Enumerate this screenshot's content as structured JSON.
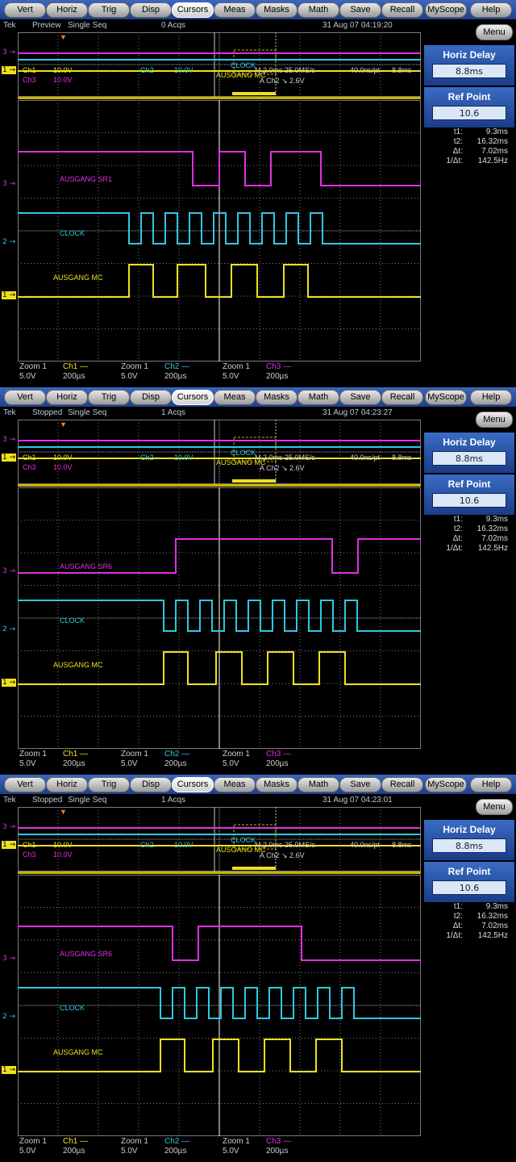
{
  "menu": [
    "Vert",
    "Horiz",
    "Trig",
    "Disp",
    "Cursors",
    "Meas",
    "Masks",
    "Math",
    "Save",
    "Recall",
    "MyScope",
    "Help"
  ],
  "active_menu": "Cursors",
  "colors": {
    "ch1": "#f0e020",
    "ch2": "#30c8e0",
    "ch3": "#e030e0",
    "grid": "#7a7a7a",
    "bg": "#000000"
  },
  "side": {
    "menu_label": "Menu",
    "horiz_delay_label": "Horiz Delay",
    "horiz_delay_value": "8.8ms",
    "ref_point_label": "Ref Point",
    "ref_point_value": "10.6",
    "cursors": [
      {
        "k": "t1:",
        "v": "9.3ms"
      },
      {
        "k": "t2:",
        "v": "16.32ms"
      },
      {
        "k": "Δt:",
        "v": "7.02ms"
      },
      {
        "k": "1/Δt:",
        "v": "142.5Hz"
      }
    ]
  },
  "overview_info": {
    "ch1": "Ch1",
    "ch1_scale": "10.0V",
    "ch2": "Ch2",
    "ch2_scale": "10.0V",
    "ch3": "Ch3",
    "ch3_scale": "10.0V",
    "timebase": "M 2.0ms 25.0MS/s",
    "resolution": "40.0ns/pt",
    "delay": "8.8ms",
    "trigger": "A  Ch2  ↘  2.6V",
    "overlay_a": "CLOCK",
    "overlay_b": "AUSGANG MC"
  },
  "bottom": [
    {
      "zoom": "Zoom 1",
      "ch": "Ch1",
      "v": "5.0V",
      "t": "200µs",
      "color": "#f0e020"
    },
    {
      "zoom": "Zoom 1",
      "ch": "Ch2",
      "v": "5.0V",
      "t": "200µs",
      "color": "#30c8e0"
    },
    {
      "zoom": "Zoom 1",
      "ch": "Ch3",
      "v": "5.0V",
      "t": "200µs",
      "color": "#e030e0"
    }
  ],
  "channel_marks": {
    "ch1": "1",
    "ch2": "2",
    "ch3": "3"
  },
  "panels": [
    {
      "brand": "Tek",
      "mode": "Preview",
      "acq_mode": "Single Seq",
      "acqs": "0 Acqs",
      "datetime": "31 Aug 07 04:19:20",
      "label_ch3": "AUSGANG SR1",
      "label_ch2": "CLOCK",
      "label_ch1": "AUSGANG MC",
      "chart_data": {
        "type": "line",
        "x_unit": "division",
        "xlim": [
          0,
          10
        ],
        "series": [
          {
            "name": "AUSGANG SR1",
            "channel": "Ch3",
            "x": [
              0,
              4.34,
              4.34,
              5.0,
              5.0,
              5.64,
              5.64,
              6.28,
              6.28,
              7.52,
              7.52,
              10
            ],
            "y": [
              1,
              1,
              0,
              0,
              1,
              1,
              0,
              0,
              1,
              1,
              0,
              0
            ]
          },
          {
            "name": "CLOCK",
            "channel": "Ch2",
            "x": [
              0,
              2.76,
              2.76,
              3.06,
              3.06,
              3.36,
              3.36,
              3.66,
              3.66,
              3.96,
              3.96,
              4.26,
              4.26,
              4.56,
              4.56,
              4.86,
              4.86,
              5.16,
              5.16,
              5.46,
              5.46,
              5.76,
              5.76,
              6.06,
              6.06,
              6.36,
              6.36,
              6.66,
              6.66,
              6.96,
              6.96,
              7.26,
              7.26,
              7.56,
              7.56,
              10
            ],
            "y": [
              1,
              1,
              0,
              0,
              1,
              1,
              0,
              0,
              1,
              1,
              0,
              0,
              1,
              1,
              0,
              0,
              1,
              1,
              0,
              0,
              1,
              1,
              0,
              0,
              1,
              1,
              0,
              0,
              1,
              1,
              0,
              0,
              1,
              1,
              0,
              0
            ]
          },
          {
            "name": "AUSGANG MC",
            "channel": "Ch1",
            "x": [
              0,
              2.76,
              2.76,
              3.36,
              3.36,
              3.96,
              3.96,
              4.66,
              4.66,
              5.3,
              5.3,
              5.94,
              5.94,
              6.6,
              6.6,
              7.2,
              7.2,
              10
            ],
            "y": [
              0,
              0,
              1,
              1,
              0,
              0,
              1,
              1,
              0,
              0,
              1,
              1,
              0,
              0,
              1,
              1,
              0,
              0
            ]
          }
        ]
      }
    },
    {
      "brand": "Tek",
      "mode": "Stopped",
      "acq_mode": "Single Seq",
      "acqs": "1 Acqs",
      "datetime": "31 Aug 07 04:23:27",
      "label_ch3": "AUSGANG SR6",
      "label_ch2": "CLOCK",
      "label_ch1": "AUSGANG MC",
      "chart_data": {
        "type": "line",
        "x_unit": "division",
        "xlim": [
          0,
          10
        ],
        "series": [
          {
            "name": "AUSGANG SR6",
            "channel": "Ch3",
            "x": [
              0,
              3.92,
              3.92,
              7.8,
              7.8,
              8.44,
              8.44,
              10
            ],
            "y": [
              0,
              0,
              1,
              1,
              0,
              0,
              1,
              1
            ]
          },
          {
            "name": "CLOCK",
            "channel": "Ch2",
            "x": [
              0,
              3.62,
              3.62,
              3.92,
              3.92,
              4.22,
              4.22,
              4.52,
              4.52,
              4.82,
              4.82,
              5.12,
              5.12,
              5.42,
              5.42,
              5.72,
              5.72,
              6.02,
              6.02,
              6.32,
              6.32,
              6.62,
              6.62,
              6.92,
              6.92,
              7.22,
              7.22,
              7.52,
              7.52,
              7.82,
              7.82,
              8.12,
              8.12,
              8.42,
              8.42,
              10
            ],
            "y": [
              1,
              1,
              0,
              0,
              1,
              1,
              0,
              0,
              1,
              1,
              0,
              0,
              1,
              1,
              0,
              0,
              1,
              1,
              0,
              0,
              1,
              1,
              0,
              0,
              1,
              1,
              0,
              0,
              1,
              1,
              0,
              0,
              1,
              1,
              0,
              0
            ]
          },
          {
            "name": "AUSGANG MC",
            "channel": "Ch1",
            "x": [
              0,
              3.62,
              3.62,
              4.22,
              4.22,
              4.92,
              4.92,
              5.56,
              5.56,
              6.2,
              6.2,
              6.84,
              6.84,
              7.48,
              7.48,
              8.12,
              8.12,
              10
            ],
            "y": [
              0,
              0,
              1,
              1,
              0,
              0,
              1,
              1,
              0,
              0,
              1,
              1,
              0,
              0,
              1,
              1,
              0,
              0
            ]
          }
        ]
      }
    },
    {
      "brand": "Tek",
      "mode": "Stopped",
      "acq_mode": "Single Seq",
      "acqs": "1 Acqs",
      "datetime": "31 Aug 07 04:23:01",
      "label_ch3": "AUSGANG SR6",
      "label_ch2": "CLOCK",
      "label_ch1": "AUSGANG MC",
      "chart_data": {
        "type": "line",
        "x_unit": "division",
        "xlim": [
          0,
          10
        ],
        "series": [
          {
            "name": "AUSGANG SR6",
            "channel": "Ch3",
            "x": [
              0,
              3.84,
              3.84,
              4.48,
              4.48,
              7.04,
              7.04,
              10
            ],
            "y": [
              1,
              1,
              0,
              0,
              1,
              1,
              0,
              0
            ]
          },
          {
            "name": "CLOCK",
            "channel": "Ch2",
            "x": [
              0,
              3.54,
              3.54,
              3.84,
              3.84,
              4.14,
              4.14,
              4.44,
              4.44,
              4.74,
              4.74,
              5.04,
              5.04,
              5.34,
              5.34,
              5.64,
              5.64,
              5.94,
              5.94,
              6.24,
              6.24,
              6.54,
              6.54,
              6.84,
              6.84,
              7.14,
              7.14,
              7.44,
              7.44,
              7.74,
              7.74,
              8.04,
              8.04,
              8.34,
              8.34,
              10
            ],
            "y": [
              1,
              1,
              0,
              0,
              1,
              1,
              0,
              0,
              1,
              1,
              0,
              0,
              1,
              1,
              0,
              0,
              1,
              1,
              0,
              0,
              1,
              1,
              0,
              0,
              1,
              1,
              0,
              0,
              1,
              1,
              0,
              0,
              1,
              1,
              0,
              0
            ]
          },
          {
            "name": "AUSGANG MC",
            "channel": "Ch1",
            "x": [
              0,
              3.54,
              3.54,
              4.14,
              4.14,
              4.84,
              4.84,
              5.48,
              5.48,
              6.12,
              6.12,
              6.76,
              6.76,
              7.4,
              7.4,
              8.04,
              8.04,
              10
            ],
            "y": [
              0,
              0,
              1,
              1,
              0,
              0,
              1,
              1,
              0,
              0,
              1,
              1,
              0,
              0,
              1,
              1,
              0,
              0
            ]
          }
        ]
      }
    }
  ]
}
